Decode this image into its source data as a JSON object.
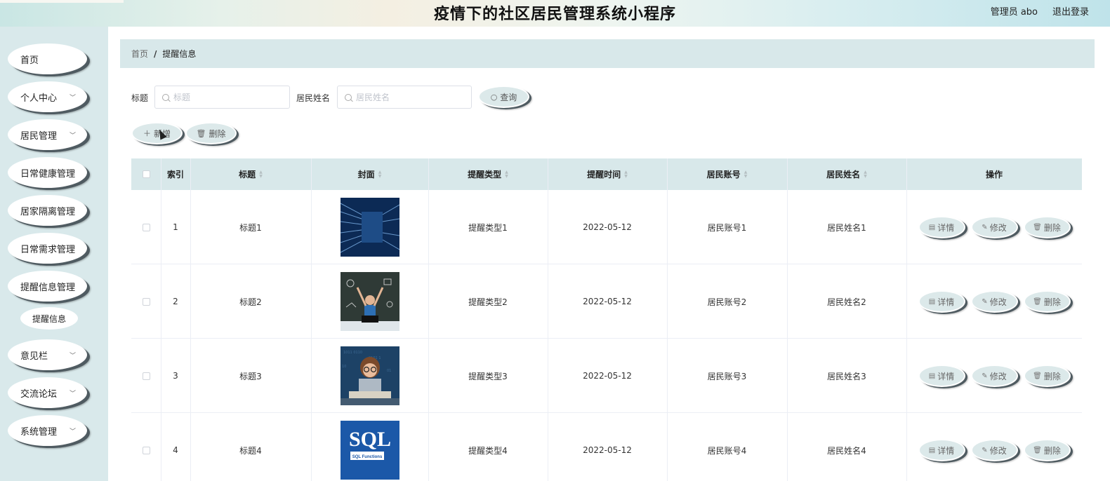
{
  "header": {
    "title": "疫情下的社区居民管理系统小程序",
    "admin_label": "管理员 abo",
    "logout_label": "退出登录"
  },
  "sidebar": {
    "items": [
      {
        "label": "首页",
        "has_chevron": false
      },
      {
        "label": "个人中心",
        "has_chevron": true
      },
      {
        "label": "居民管理",
        "has_chevron": true
      },
      {
        "label": "日常健康管理",
        "has_chevron": false
      },
      {
        "label": "居家隔离管理",
        "has_chevron": false
      },
      {
        "label": "日常需求管理",
        "has_chevron": false
      },
      {
        "label": "提醒信息管理",
        "has_chevron": false
      },
      {
        "label": "意见栏",
        "has_chevron": true
      },
      {
        "label": "交流论坛",
        "has_chevron": true
      },
      {
        "label": "系统管理",
        "has_chevron": true
      }
    ],
    "submenu_item": "提醒信息"
  },
  "breadcrumb": {
    "home": "首页",
    "separator": "/",
    "current": "提醒信息"
  },
  "search": {
    "title_label": "标题",
    "title_placeholder": "标题",
    "name_label": "居民姓名",
    "name_placeholder": "居民姓名",
    "query_button": "查询"
  },
  "actions": {
    "add_button": "新增",
    "delete_button": "删除"
  },
  "table": {
    "columns": [
      "索引",
      "标题",
      "封面",
      "提醒类型",
      "提醒时间",
      "居民账号",
      "居民姓名",
      "操作"
    ],
    "rows": [
      {
        "index": "1",
        "title": "标题1",
        "type": "提醒类型1",
        "time": "2022-05-12",
        "account": "居民账号1",
        "name": "居民姓名1"
      },
      {
        "index": "2",
        "title": "标题2",
        "type": "提醒类型2",
        "time": "2022-05-12",
        "account": "居民账号2",
        "name": "居民姓名2"
      },
      {
        "index": "3",
        "title": "标题3",
        "type": "提醒类型3",
        "time": "2022-05-12",
        "account": "居民账号3",
        "name": "居民姓名3"
      },
      {
        "index": "4",
        "title": "标题4",
        "type": "提醒类型4",
        "time": "2022-05-12",
        "account": "居民账号4",
        "name": "居民姓名4"
      }
    ],
    "op_labels": {
      "detail": "详情",
      "edit": "修改",
      "delete": "删除"
    },
    "cover_4_text": {
      "big": "SQL",
      "small": "SQL Functions"
    }
  }
}
